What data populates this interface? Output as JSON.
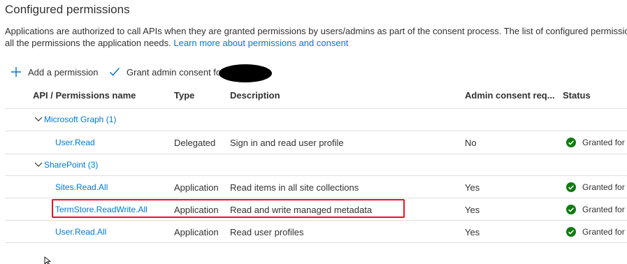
{
  "section": {
    "title": "Configured permissions",
    "description": "Applications are authorized to call APIs when they are granted permissions by users/admins as part of the consent process. The list of configured permissio",
    "description_line2": "all the permissions the application needs. ",
    "learn_more_link": "Learn more about permissions and consent"
  },
  "toolbar": {
    "add_label": "Add a permission",
    "grant_label": "Grant admin consent fo"
  },
  "columns": {
    "api": "API / Permissions name",
    "type": "Type",
    "description": "Description",
    "admin": "Admin consent req...",
    "status": "Status"
  },
  "groups": [
    {
      "label": "Microsoft Graph (1)",
      "items": [
        {
          "name": "User.Read",
          "type": "Delegated",
          "description": "Sign in and read user profile",
          "admin": "No",
          "status": "Granted for"
        }
      ]
    },
    {
      "label": "SharePoint (3)",
      "items": [
        {
          "name": "Sites.Read.All",
          "type": "Application",
          "description": "Read items in all site collections",
          "admin": "Yes",
          "status": "Granted for"
        },
        {
          "name": "TermStore.ReadWrite.All",
          "type": "Application",
          "description": "Read and write managed metadata",
          "admin": "Yes",
          "status": "Granted for"
        },
        {
          "name": "User.Read.All",
          "type": "Application",
          "description": "Read user profiles",
          "admin": "Yes",
          "status": "Granted for"
        }
      ]
    }
  ],
  "colors": {
    "accent": "#0078d4",
    "granted": "#107c10",
    "highlight": "#e81123"
  },
  "icons": {
    "add": "plus-icon",
    "grant": "checkmark-icon",
    "group_toggle": "chevron-down-icon",
    "status": "check-circle-icon"
  }
}
